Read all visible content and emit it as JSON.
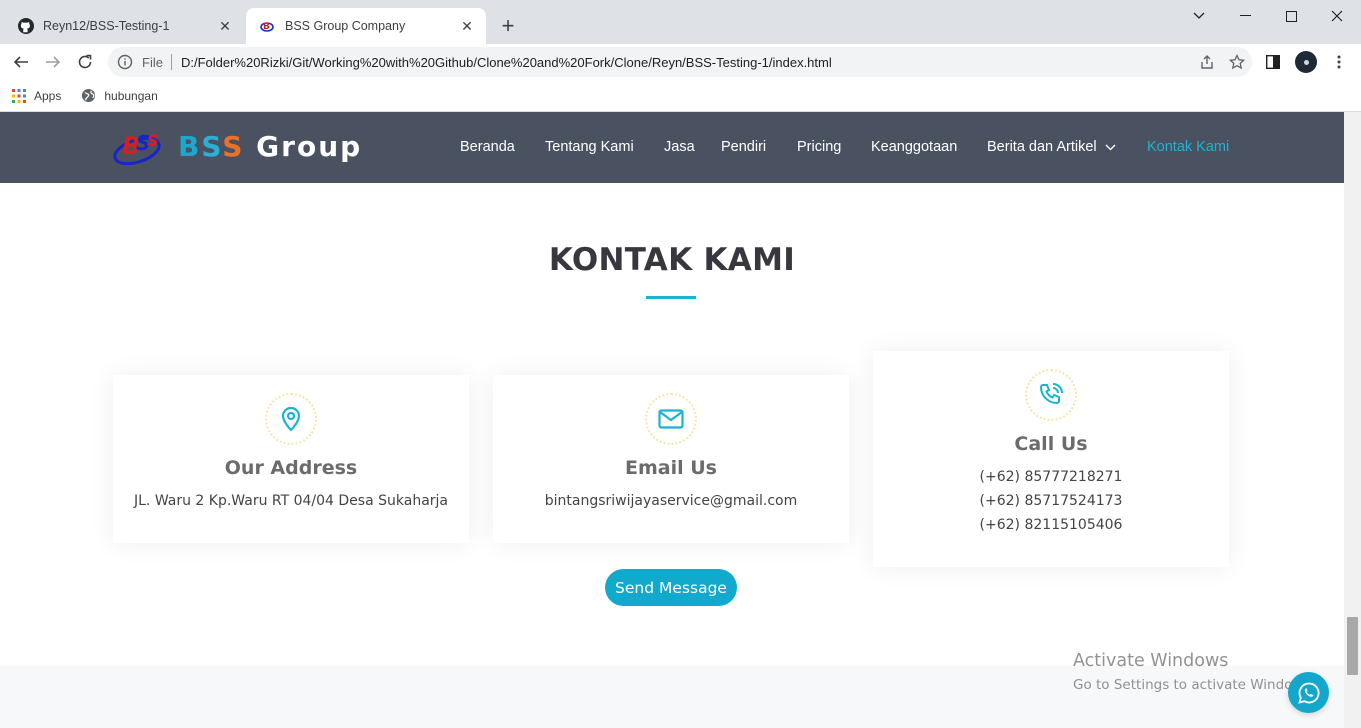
{
  "browser": {
    "tabs": [
      {
        "title": "Reyn12/BSS-Testing-1",
        "icon": "github-icon",
        "active": false
      },
      {
        "title": "BSS Group Company",
        "icon": "bss-logo-icon",
        "active": true
      }
    ],
    "address": {
      "scheme": "File",
      "url": "D:/Folder%20Rizki/Git/Working%20with%20Github/Clone%20and%20Fork/Clone/Reyn/BSS-Testing-1/index.html"
    },
    "bookmarks": [
      {
        "label": "Apps",
        "icon": "apps-grid-icon"
      },
      {
        "label": "hubungan",
        "icon": "globe-icon"
      }
    ]
  },
  "site": {
    "logo_text": {
      "b": "B",
      "s1": "S",
      "s2": "S",
      "rest": " Group"
    },
    "nav": [
      {
        "label": "Beranda"
      },
      {
        "label": "Tentang Kami"
      },
      {
        "label": "Jasa"
      },
      {
        "label": "Pendiri"
      },
      {
        "label": "Pricing"
      },
      {
        "label": "Keanggotaan"
      },
      {
        "label": "Berita dan Artikel"
      },
      {
        "label": "Kontak Kami",
        "active": true
      }
    ],
    "accent_color": "#1ab3d1",
    "header_color": "#4a5160"
  },
  "contact": {
    "title": "KONTAK KAMI",
    "cards": [
      {
        "heading": "Our Address",
        "icon": "map-pin-icon",
        "lines": [
          "JL. Waru 2 Kp.Waru RT 04/04 Desa Sukaharja"
        ]
      },
      {
        "heading": "Email Us",
        "icon": "envelope-icon",
        "lines": [
          "bintangsriwijayaservice@gmail.com"
        ]
      },
      {
        "heading": "Call Us",
        "icon": "phone-call-icon",
        "lines": [
          "(+62) 85777218271",
          "(+62) 85717524173",
          "(+62) 82115105406"
        ]
      }
    ],
    "send_button": "Send Message"
  },
  "overlay": {
    "activate_title": "Activate Windows",
    "activate_sub": "Go to Settings to activate Windows."
  }
}
